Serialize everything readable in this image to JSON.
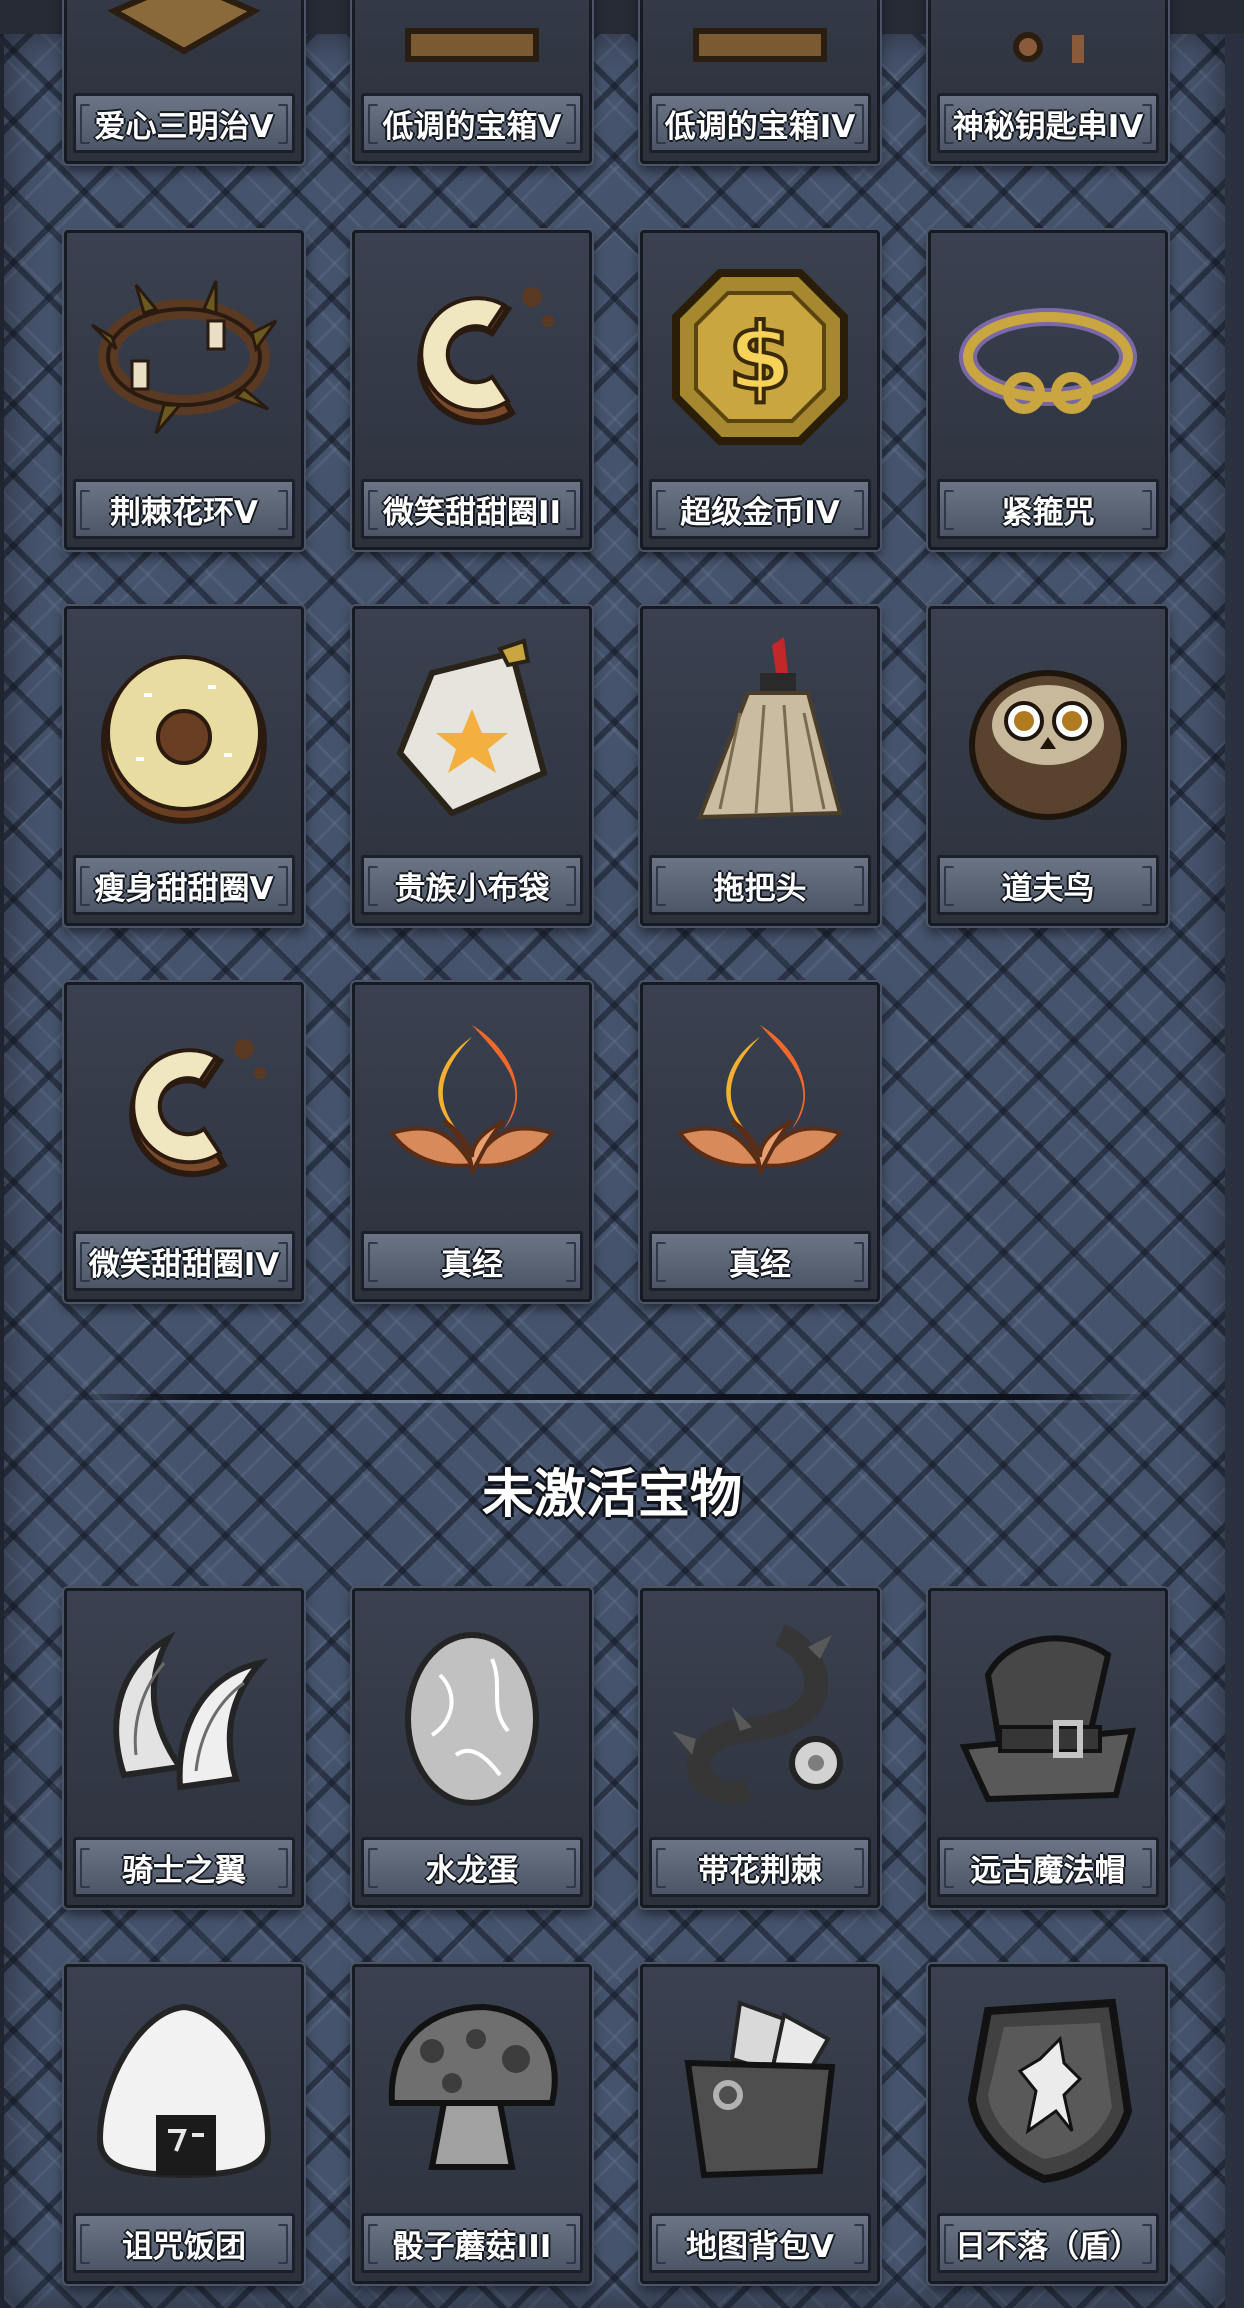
{
  "top_row": [
    {
      "name": "爱心三明治V",
      "icon": "sandwich-icon"
    },
    {
      "name": "低调的宝箱V",
      "icon": "chest-icon"
    },
    {
      "name": "低调的宝箱IV",
      "icon": "chest-icon"
    },
    {
      "name": "神秘钥匙串IV",
      "icon": "keychain-icon"
    }
  ],
  "active_items": [
    {
      "name": "荆棘花环V",
      "icon": "thorn-wreath-icon"
    },
    {
      "name": "微笑甜甜圈II",
      "icon": "smile-donut-icon"
    },
    {
      "name": "超级金币IV",
      "icon": "gold-coin-icon"
    },
    {
      "name": "紧箍咒",
      "icon": "golden-headband-icon"
    },
    {
      "name": "瘦身甜甜圈V",
      "icon": "donut-icon"
    },
    {
      "name": "贵族小布袋",
      "icon": "cloth-bag-icon"
    },
    {
      "name": "拖把头",
      "icon": "mop-head-icon"
    },
    {
      "name": "道夫鸟",
      "icon": "owl-bird-icon"
    },
    {
      "name": "微笑甜甜圈IV",
      "icon": "smile-donut-icon"
    },
    {
      "name": "真经",
      "icon": "fire-lotus-icon"
    },
    {
      "name": "真经",
      "icon": "fire-lotus-icon"
    }
  ],
  "inactive_section": {
    "title": "未激活宝物",
    "items": [
      {
        "name": "骑士之翼",
        "icon": "wings-icon"
      },
      {
        "name": "水龙蛋",
        "icon": "dragon-egg-icon"
      },
      {
        "name": "带花荆棘",
        "icon": "flower-thorn-icon"
      },
      {
        "name": "远古魔法帽",
        "icon": "wizard-hat-icon"
      },
      {
        "name": "诅咒饭团",
        "icon": "rice-ball-icon"
      },
      {
        "name": "骰子蘑菇III",
        "icon": "dice-mushroom-icon"
      },
      {
        "name": "地图背包V",
        "icon": "map-backpack-icon"
      },
      {
        "name": "日不落（盾）",
        "icon": "lion-shield-icon"
      }
    ]
  }
}
